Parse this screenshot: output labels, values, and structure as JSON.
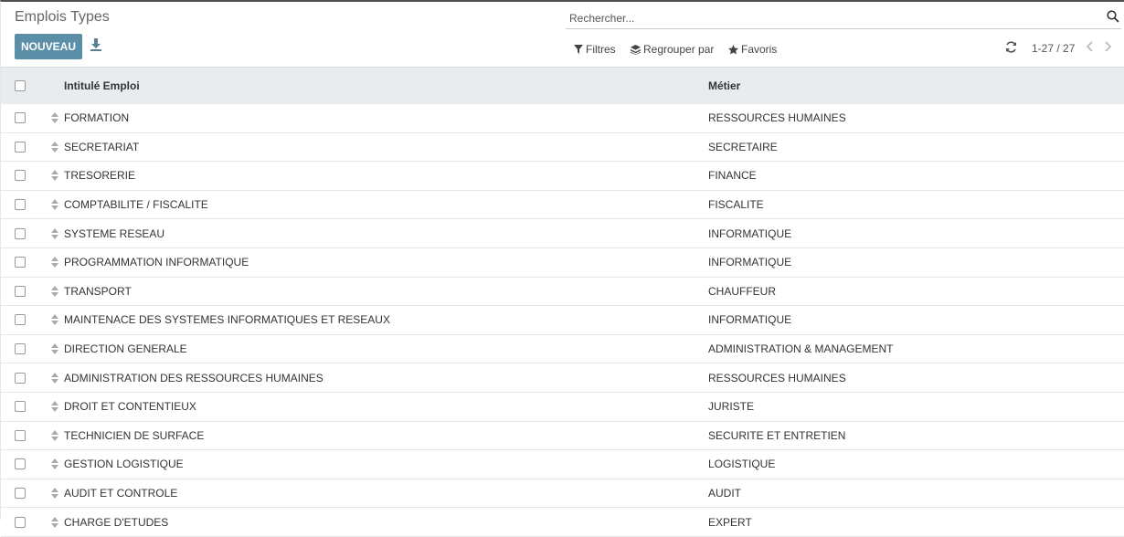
{
  "header": {
    "title": "Emplois Types",
    "new_button": "NOUVEAU",
    "download_icon": "download-icon"
  },
  "search": {
    "placeholder": "Rechercher...",
    "icon": "search-icon"
  },
  "toolbar": {
    "filters": "Filtres",
    "group_by": "Regrouper par",
    "favorites": "Favoris"
  },
  "pager": {
    "value": "1-27 / 27"
  },
  "table": {
    "columns": [
      "Intitulé Emploi",
      "Métier"
    ],
    "rows": [
      {
        "job": "FORMATION",
        "trade": "RESSOURCES HUMAINES"
      },
      {
        "job": "SECRETARIAT",
        "trade": "SECRETAIRE"
      },
      {
        "job": "TRESORERIE",
        "trade": "FINANCE"
      },
      {
        "job": "COMPTABILITE / FISCALITE",
        "trade": "FISCALITE"
      },
      {
        "job": "SYSTEME RESEAU",
        "trade": "INFORMATIQUE"
      },
      {
        "job": "PROGRAMMATION INFORMATIQUE",
        "trade": "INFORMATIQUE"
      },
      {
        "job": "TRANSPORT",
        "trade": "CHAUFFEUR"
      },
      {
        "job": "MAINTENACE DES SYSTEMES INFORMATIQUES ET RESEAUX",
        "trade": "INFORMATIQUE"
      },
      {
        "job": "DIRECTION GENERALE",
        "trade": "ADMINISTRATION & MANAGEMENT"
      },
      {
        "job": "ADMINISTRATION DES RESSOURCES HUMAINES",
        "trade": "RESSOURCES HUMAINES"
      },
      {
        "job": "DROIT ET CONTENTIEUX",
        "trade": "JURISTE"
      },
      {
        "job": "TECHNICIEN DE SURFACE",
        "trade": "SECURITE ET ENTRETIEN"
      },
      {
        "job": "GESTION LOGISTIQUE",
        "trade": "LOGISTIQUE"
      },
      {
        "job": "AUDIT ET CONTROLE",
        "trade": "AUDIT"
      },
      {
        "job": "CHARGE D'ETUDES",
        "trade": "EXPERT"
      }
    ]
  },
  "colors": {
    "primary": "#5b8fa8",
    "header_bg": "#e9ecef"
  }
}
